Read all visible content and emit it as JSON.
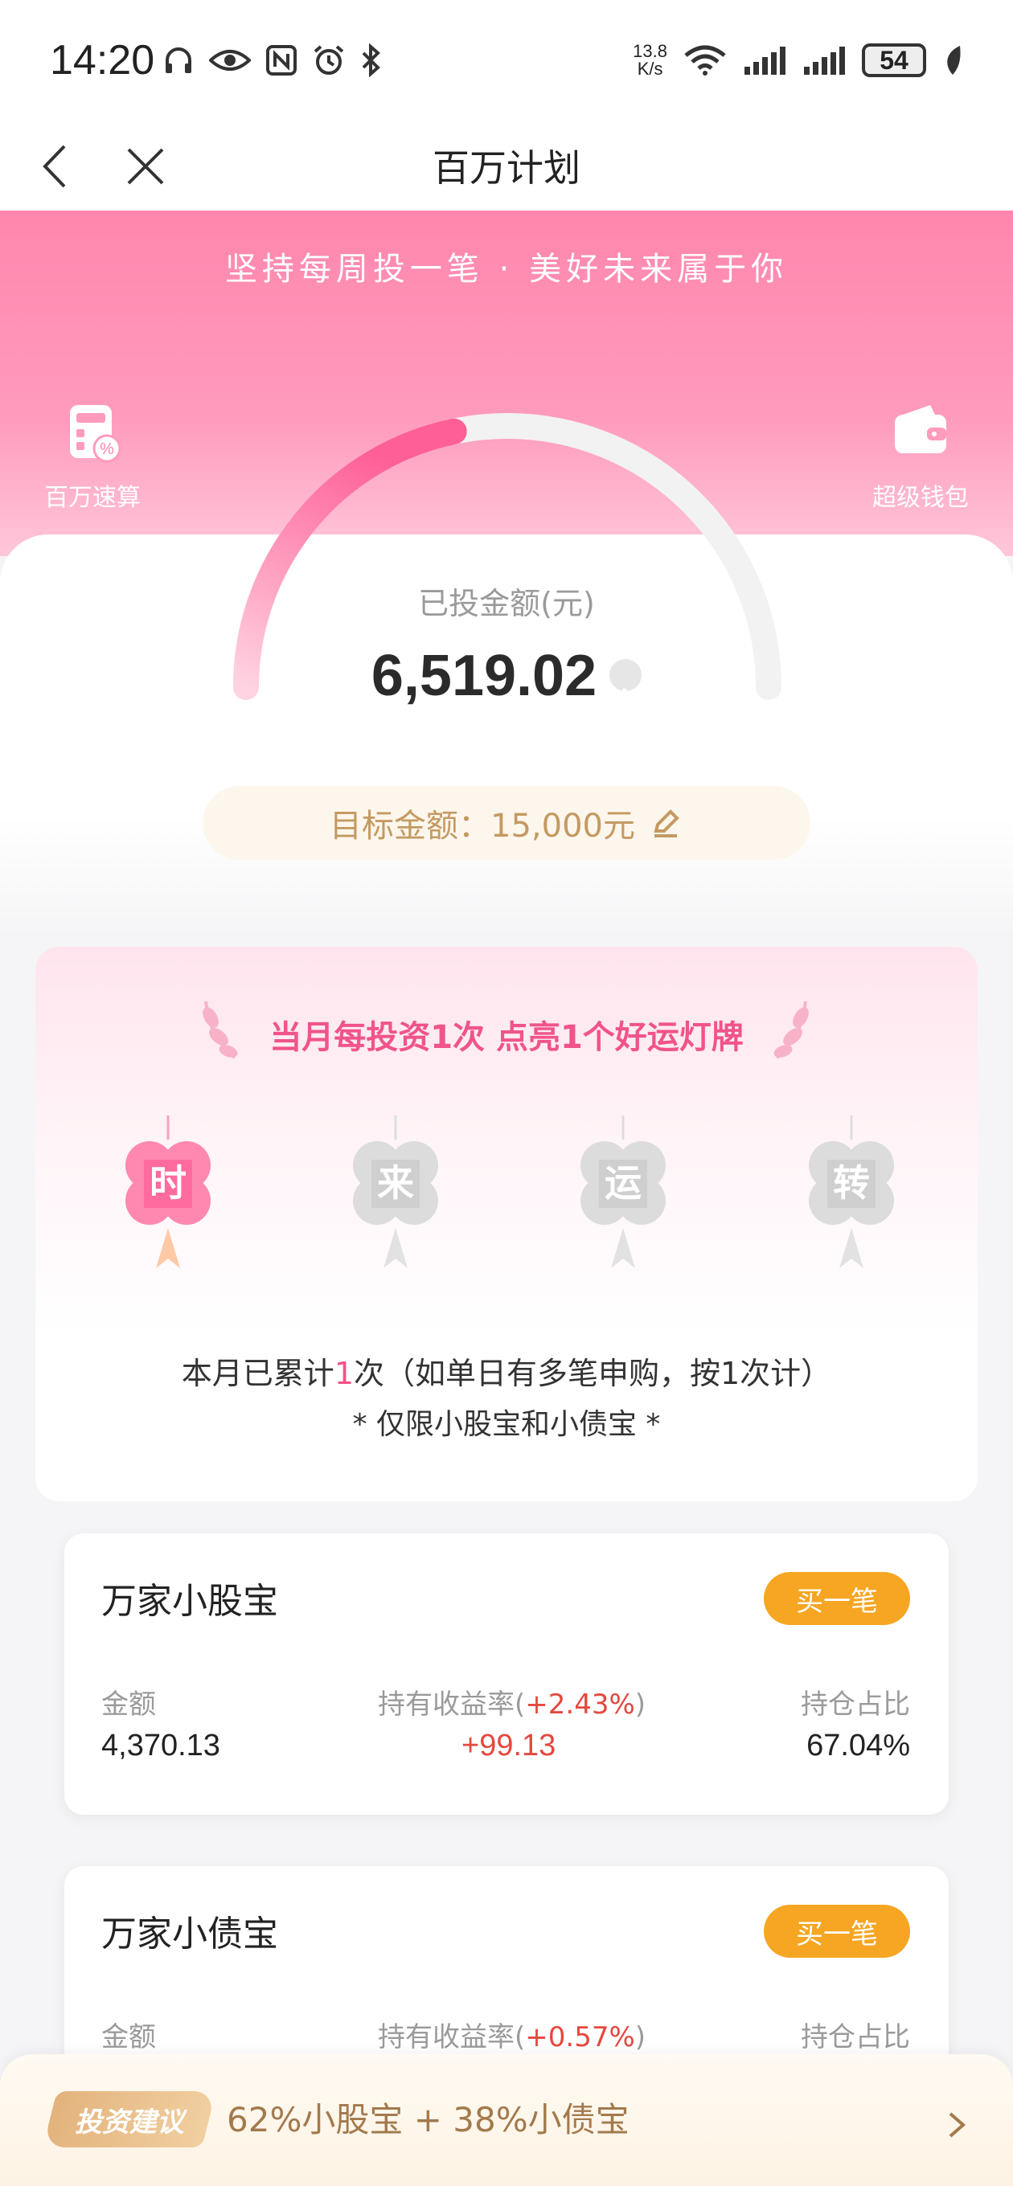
{
  "status_bar": {
    "time": "14:20",
    "net_speed_value": "13.8",
    "net_speed_unit": "K/s",
    "battery": "54",
    "icons": [
      "headphones-icon",
      "eye-icon",
      "nfc-icon",
      "alarm-icon",
      "bluetooth-icon",
      "wifi-icon",
      "signal-icon",
      "signal-icon",
      "leaf-icon"
    ]
  },
  "nav": {
    "title": "百万计划",
    "back_icon": "chevron-left-icon",
    "close_icon": "close-icon"
  },
  "hero": {
    "slogan": "坚持每周投一笔 · 美好未来属于你",
    "left_tool_label": "百万速算",
    "right_tool_label": "超级钱包"
  },
  "progress": {
    "invested_label": "已投金额(元)",
    "invested_amount": "6,519.02",
    "target_label": "目标金额：15,000元",
    "fraction": 0.4346
  },
  "lucky": {
    "title": "当月每投资1次 点亮1个好运灯牌",
    "clovers": [
      {
        "char": "时",
        "lit": true
      },
      {
        "char": "来",
        "lit": false
      },
      {
        "char": "运",
        "lit": false
      },
      {
        "char": "转",
        "lit": false
      }
    ],
    "cumulative_prefix": "本月已累计",
    "cumulative_count": "1",
    "cumulative_suffix": "次（如单日有多笔申购，按1次计）",
    "limit_note": "* 仅限小股宝和小债宝 *"
  },
  "funds": [
    {
      "name": "万家小股宝",
      "buy_label": "买一笔",
      "amount_label": "金额",
      "amount": "4,370.13",
      "return_label_prefix": "持有收益率(",
      "return_rate": "+2.43%",
      "return_label_suffix": ")",
      "return_value": "+99.13",
      "ratio_label": "持仓占比",
      "ratio": "67.04%"
    },
    {
      "name": "万家小债宝",
      "buy_label": "买一笔",
      "amount_label": "金额",
      "return_label_prefix": "持有收益率(",
      "return_rate": "+0.57%",
      "return_label_suffix": ")",
      "ratio_label": "持仓占比"
    }
  ],
  "advice": {
    "badge": "投资建议",
    "text": "62%小股宝 + 38%小债宝"
  },
  "colors": {
    "pink": "#f0548a",
    "gold": "#c49a62",
    "orange": "#f6a623",
    "red": "#e5483f"
  }
}
